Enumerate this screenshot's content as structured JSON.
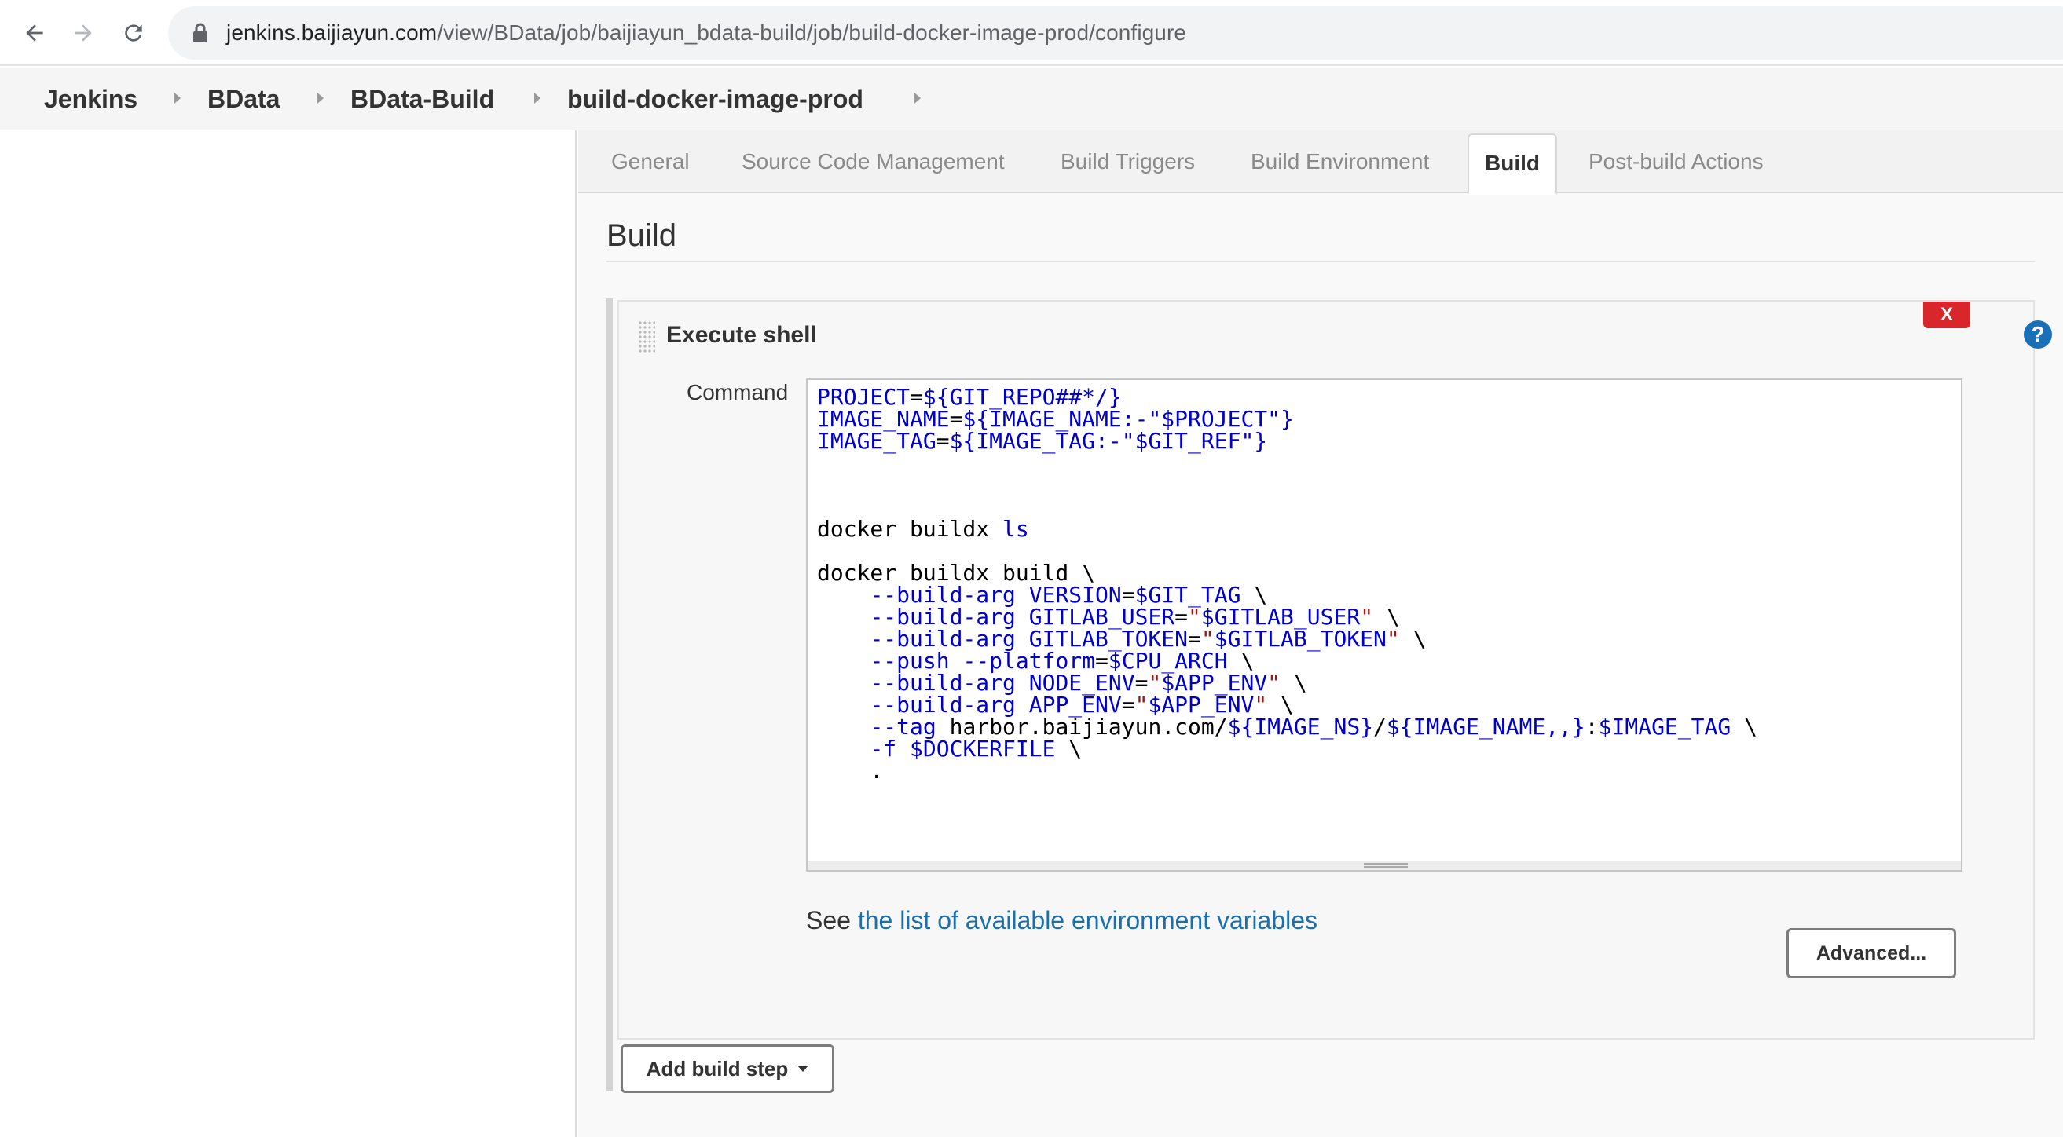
{
  "browser": {
    "url_host": "jenkins.baijiayun.com",
    "url_path": "/view/BData/job/baijiayun_bdata-build/job/build-docker-image-prod/configure",
    "icons": [
      "back-arrow-icon",
      "forward-arrow-icon",
      "reload-icon",
      "lock-icon"
    ]
  },
  "breadcrumb": {
    "items": [
      {
        "label": "Jenkins"
      },
      {
        "label": "BData"
      },
      {
        "label": "BData-Build"
      },
      {
        "label": "build-docker-image-prod"
      }
    ]
  },
  "tabs": [
    {
      "label": "General",
      "active": false
    },
    {
      "label": "Source Code Management",
      "active": false
    },
    {
      "label": "Build Triggers",
      "active": false
    },
    {
      "label": "Build Environment",
      "active": false
    },
    {
      "label": "Build",
      "active": true
    },
    {
      "label": "Post-build Actions",
      "active": false
    }
  ],
  "section": {
    "title": "Build"
  },
  "build_step": {
    "title": "Execute shell",
    "delete_label": "X",
    "help_label": "?",
    "command_label": "Command",
    "command_lines": [
      "PROJECT=${GIT_REPO##*/}",
      "IMAGE_NAME=${IMAGE_NAME:-\"$PROJECT\"}",
      "IMAGE_TAG=${IMAGE_TAG:-\"$GIT_REF\"}",
      "",
      "",
      "",
      "docker buildx ls",
      "",
      "docker buildx build \\",
      "    --build-arg VERSION=$GIT_TAG \\",
      "    --build-arg GITLAB_USER=\"$GITLAB_USER\" \\",
      "    --build-arg GITLAB_TOKEN=\"$GITLAB_TOKEN\" \\",
      "    --push --platform=$CPU_ARCH \\",
      "    --build-arg NODE_ENV=\"$APP_ENV\" \\",
      "    --build-arg APP_ENV=\"$APP_ENV\" \\",
      "    --tag harbor.baijiayun.com/${IMAGE_NS}/${IMAGE_NAME,,}:$IMAGE_TAG \\",
      "    -f $DOCKERFILE \\",
      "    ."
    ],
    "env_help_prefix": "See ",
    "env_help_link": "the list of available environment variables",
    "advanced_label": "Advanced..."
  },
  "add_step_label": "Add build step",
  "colors": {
    "variable": "#0000cc",
    "string": "#aa1111",
    "link": "#1a6fad",
    "delete": "#d9262a",
    "help": "#1a70b8"
  }
}
